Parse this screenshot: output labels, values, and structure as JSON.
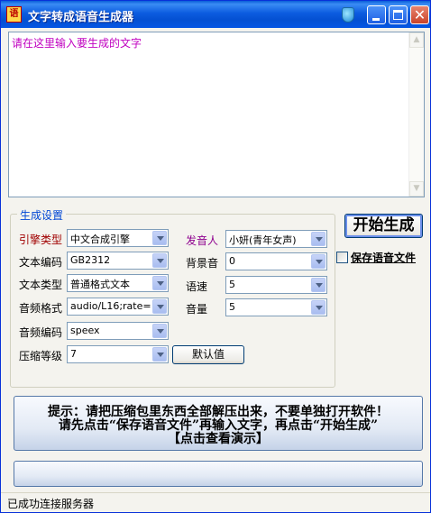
{
  "window": {
    "title": "文字转成语音生成器",
    "app_icon": "app-logo-icon",
    "controls": [
      "help-icon",
      "minimize-icon",
      "maximize-icon",
      "close-icon"
    ]
  },
  "input": {
    "placeholder": "请在这里输入要生成的文字"
  },
  "settings": {
    "group_title": "生成设置",
    "engine_type": {
      "label": "引擎类型",
      "value": "中文合成引擎"
    },
    "text_encoding": {
      "label": "文本编码",
      "value": "GB2312"
    },
    "text_type": {
      "label": "文本类型",
      "value": "普通格式文本"
    },
    "audio_format": {
      "label": "音频格式",
      "value": "audio/L16;rate="
    },
    "audio_codec": {
      "label": "音频编码",
      "value": "speex"
    },
    "compression_level": {
      "label": "压缩等级",
      "value": "7"
    },
    "speaker": {
      "label": "发音人",
      "value": "小妍(青年女声)"
    },
    "background_sound": {
      "label": "背景音",
      "value": "0"
    },
    "speed": {
      "label": "语速",
      "value": "5"
    },
    "volume": {
      "label": "音量",
      "value": "5"
    },
    "default_button": "默认值"
  },
  "actions": {
    "start_button": "开始生成",
    "save_checkbox_label": "保存语音文件",
    "save_checked": false
  },
  "hint": {
    "line1": "提示：请把压缩包里东西全部解压出来，不要单独打开软件！",
    "line2": "请先点击“保存语音文件”再输入文字，再点击“开始生成”",
    "line3": "【点击查看演示】"
  },
  "progress": {
    "value": 0
  },
  "status": {
    "text": "已成功连接服务器"
  },
  "colors": {
    "titlebar": "#0556E4",
    "window_bg": "#F4F3EE",
    "placeholder_text": "#C000C0",
    "label_red": "#A00000",
    "label_purple": "#8E008E",
    "group_title": "#0046D5"
  }
}
